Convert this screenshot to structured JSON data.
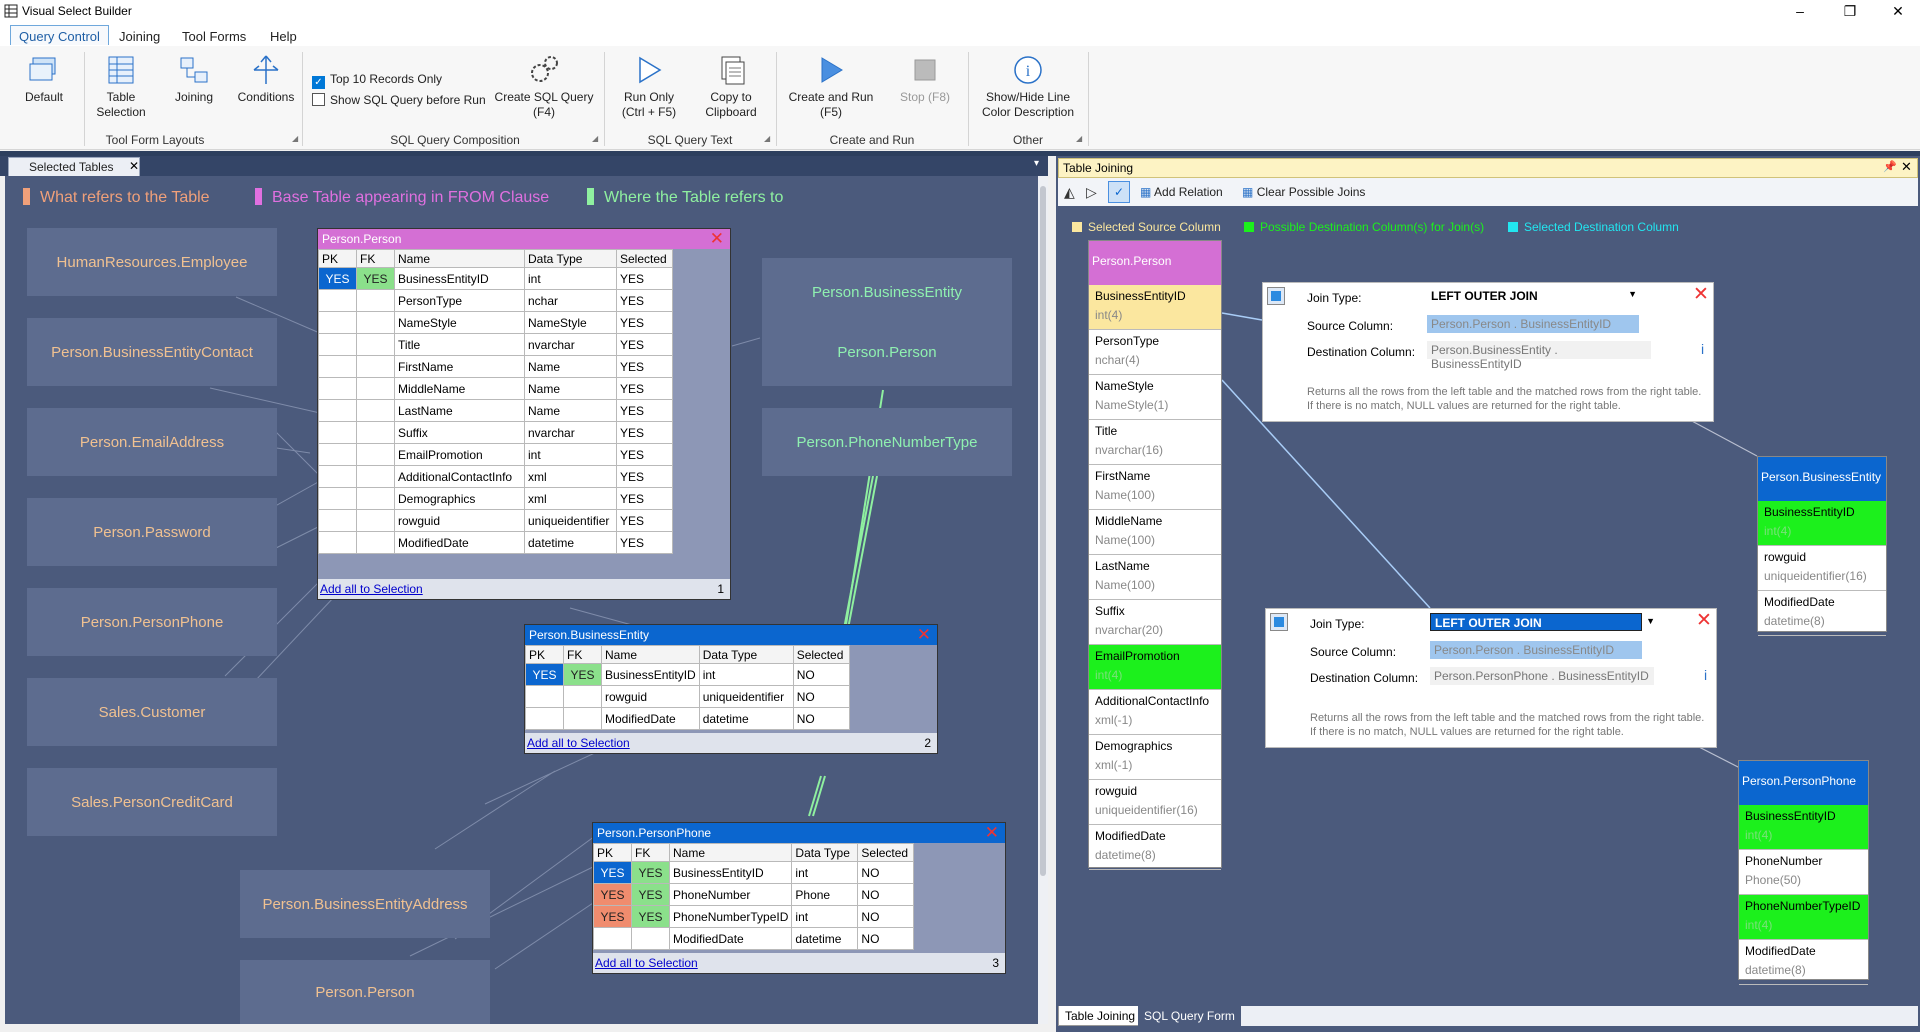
{
  "app": {
    "title": "Visual Select Builder"
  },
  "menu": [
    "Query Control",
    "Joining",
    "Tool Forms",
    "Help"
  ],
  "ribbon": {
    "default": "Default",
    "table_selection": [
      "Table",
      "Selection"
    ],
    "joining": "Joining",
    "conditions": "Conditions",
    "group1": "Tool Form Layouts",
    "top10": "Top 10 Records Only",
    "showsql": "Show SQL Query before Run",
    "create_sql": [
      "Create SQL Query",
      "(F4)"
    ],
    "group2": "SQL Query Composition",
    "run_only": [
      "Run Only",
      "(Ctrl + F5)"
    ],
    "copy": [
      "Copy to",
      "Clipboard"
    ],
    "group3": "SQL Query Text",
    "create_run": [
      "Create and Run",
      "(F5)"
    ],
    "stop": "Stop (F8)",
    "group4": "Create and Run",
    "showhide": [
      "Show/Hide Line",
      "Color Description"
    ],
    "group5": "Other"
  },
  "left": {
    "tab": "Selected Tables",
    "legend": [
      {
        "text": "What refers to the Table",
        "color": "#f0a07a"
      },
      {
        "text": "Base Table appearing in FROM Clause",
        "color": "#e070e0"
      },
      {
        "text": "Where the Table refers to",
        "color": "#8ff0a0"
      }
    ],
    "refs_left": [
      "HumanResources.Employee",
      "Person.BusinessEntityContact",
      "Person.EmailAddress",
      "Person.Password",
      "Person.PersonPhone",
      "Sales.Customer",
      "Sales.PersonCreditCard"
    ],
    "refs_bottom": [
      "Person.BusinessEntityAddress",
      "Person.Person"
    ],
    "refs_right": [
      "Person.BusinessEntity",
      "Person.Person",
      "Person.PhoneNumberType"
    ],
    "headers": [
      "PK",
      "FK",
      "Name",
      "Data Type",
      "Selected"
    ],
    "add_all": "Add all to Selection",
    "t1": {
      "title": "Person.Person",
      "num": "1",
      "rows": [
        [
          "YES",
          "YES",
          "BusinessEntityID",
          "int",
          "YES"
        ],
        [
          "",
          "",
          "PersonType",
          "nchar",
          "YES"
        ],
        [
          "",
          "",
          "NameStyle",
          "NameStyle",
          "YES"
        ],
        [
          "",
          "",
          "Title",
          "nvarchar",
          "YES"
        ],
        [
          "",
          "",
          "FirstName",
          "Name",
          "YES"
        ],
        [
          "",
          "",
          "MiddleName",
          "Name",
          "YES"
        ],
        [
          "",
          "",
          "LastName",
          "Name",
          "YES"
        ],
        [
          "",
          "",
          "Suffix",
          "nvarchar",
          "YES"
        ],
        [
          "",
          "",
          "EmailPromotion",
          "int",
          "YES"
        ],
        [
          "",
          "",
          "AdditionalContactInfo",
          "xml",
          "YES"
        ],
        [
          "",
          "",
          "Demographics",
          "xml",
          "YES"
        ],
        [
          "",
          "",
          "rowguid",
          "uniqueidentifier",
          "YES"
        ],
        [
          "",
          "",
          "ModifiedDate",
          "datetime",
          "YES"
        ]
      ]
    },
    "t2": {
      "title": "Person.BusinessEntity",
      "num": "2",
      "rows": [
        [
          "YES",
          "YES",
          "BusinessEntityID",
          "int",
          "NO"
        ],
        [
          "",
          "",
          "rowguid",
          "uniqueidentifier",
          "NO"
        ],
        [
          "",
          "",
          "ModifiedDate",
          "datetime",
          "NO"
        ]
      ]
    },
    "t3": {
      "title": "Person.PersonPhone",
      "num": "3",
      "rows": [
        [
          "YES",
          "YES",
          "BusinessEntityID",
          "int",
          "NO"
        ],
        [
          "YES",
          "YES",
          "PhoneNumber",
          "Phone",
          "NO"
        ],
        [
          "YES",
          "YES",
          "PhoneNumberTypeID",
          "int",
          "NO"
        ],
        [
          "",
          "",
          "ModifiedDate",
          "datetime",
          "NO"
        ]
      ]
    }
  },
  "right": {
    "title": "Table Joining",
    "add_relation": "Add Relation",
    "clear_joins": "Clear Possible Joins",
    "legend": [
      {
        "text": "Selected Source Column",
        "color": "#fbe79f"
      },
      {
        "text": "Possible Destination Column(s) for Join(s)",
        "color": "#1cf01c"
      },
      {
        "text": "Selected Destination Column",
        "color": "#22e6f0"
      }
    ],
    "person": {
      "title": "Person.Person",
      "cols": [
        [
          "BusinessEntityID",
          "int(4)",
          "y"
        ],
        [
          "PersonType",
          "nchar(4)",
          ""
        ],
        [
          "NameStyle",
          "NameStyle(1)",
          ""
        ],
        [
          "Title",
          "nvarchar(16)",
          ""
        ],
        [
          "FirstName",
          "Name(100)",
          ""
        ],
        [
          "MiddleName",
          "Name(100)",
          ""
        ],
        [
          "LastName",
          "Name(100)",
          ""
        ],
        [
          "Suffix",
          "nvarchar(20)",
          ""
        ],
        [
          "EmailPromotion",
          "int(4)",
          "g"
        ],
        [
          "AdditionalContactInfo",
          "xml(-1)",
          ""
        ],
        [
          "Demographics",
          "xml(-1)",
          ""
        ],
        [
          "rowguid",
          "uniqueidentifier(16)",
          ""
        ],
        [
          "ModifiedDate",
          "datetime(8)",
          ""
        ]
      ]
    },
    "be": {
      "title": "Person.BusinessEntity",
      "cols": [
        [
          "BusinessEntityID",
          "int(4)",
          "g"
        ],
        [
          "rowguid",
          "uniqueidentifier(16)",
          ""
        ],
        [
          "ModifiedDate",
          "datetime(8)",
          ""
        ]
      ]
    },
    "pp": {
      "title": "Person.PersonPhone",
      "cols": [
        [
          "BusinessEntityID",
          "int(4)",
          "g"
        ],
        [
          "PhoneNumber",
          "Phone(50)",
          ""
        ],
        [
          "PhoneNumberTypeID",
          "int(4)",
          "g"
        ],
        [
          "ModifiedDate",
          "datetime(8)",
          ""
        ]
      ]
    },
    "join_type_label": "Join Type:",
    "source_label": "Source Column:",
    "dest_label": "Destination Column:",
    "j1": {
      "type": "LEFT OUTER JOIN",
      "source": "Person.Person . BusinessEntityID",
      "dest": "Person.BusinessEntity . BusinessEntityID"
    },
    "j2": {
      "type": "LEFT OUTER JOIN",
      "source": "Person.Person . BusinessEntityID",
      "dest": "Person.PersonPhone . BusinessEntityID"
    },
    "desc": "Returns all the rows from the left table and the matched rows from the right table. If there is no match, NULL values are returned for the right table.",
    "bottom_tabs": [
      "Table Joining",
      "SQL Query Form"
    ]
  }
}
